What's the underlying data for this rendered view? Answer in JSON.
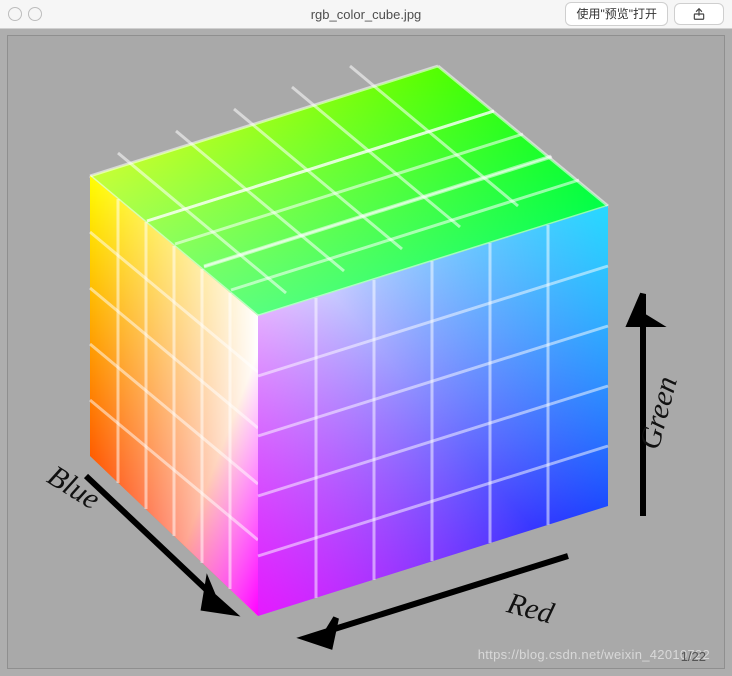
{
  "toolbar": {
    "filename": "rgb_color_cube.jpg",
    "open_button": "使用\"预览\"打开"
  },
  "image": {
    "axis_blue": "Blue",
    "axis_red": "Red",
    "axis_green": "Green",
    "cube_divisions": 6,
    "description": "RGB color cube"
  },
  "watermark": "https://blog.csdn.net/weixin_42010722",
  "page_indicator": "1/22"
}
